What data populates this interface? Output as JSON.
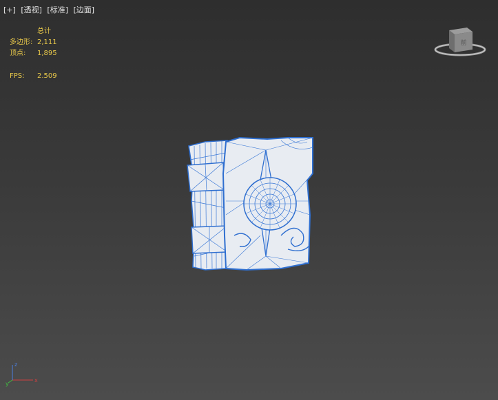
{
  "viewport": {
    "labels": [
      "[+]",
      "[透视]",
      "[标准]",
      "[边面]"
    ]
  },
  "stats": {
    "total_label": "总计",
    "polygons_label": "多边形:",
    "polygons_value": "2,111",
    "vertices_label": "顶点:",
    "vertices_value": "1,895",
    "fps_label": "FPS:",
    "fps_value": "2.509"
  },
  "viewcube": {
    "face_label": "前"
  },
  "axis": {
    "x_label": "x",
    "y_label": "y",
    "z_label": "z"
  },
  "colors": {
    "stats_text": "#e8c84a",
    "wire": "#2f6fd0",
    "mesh_fill": "#e8ecf2"
  }
}
